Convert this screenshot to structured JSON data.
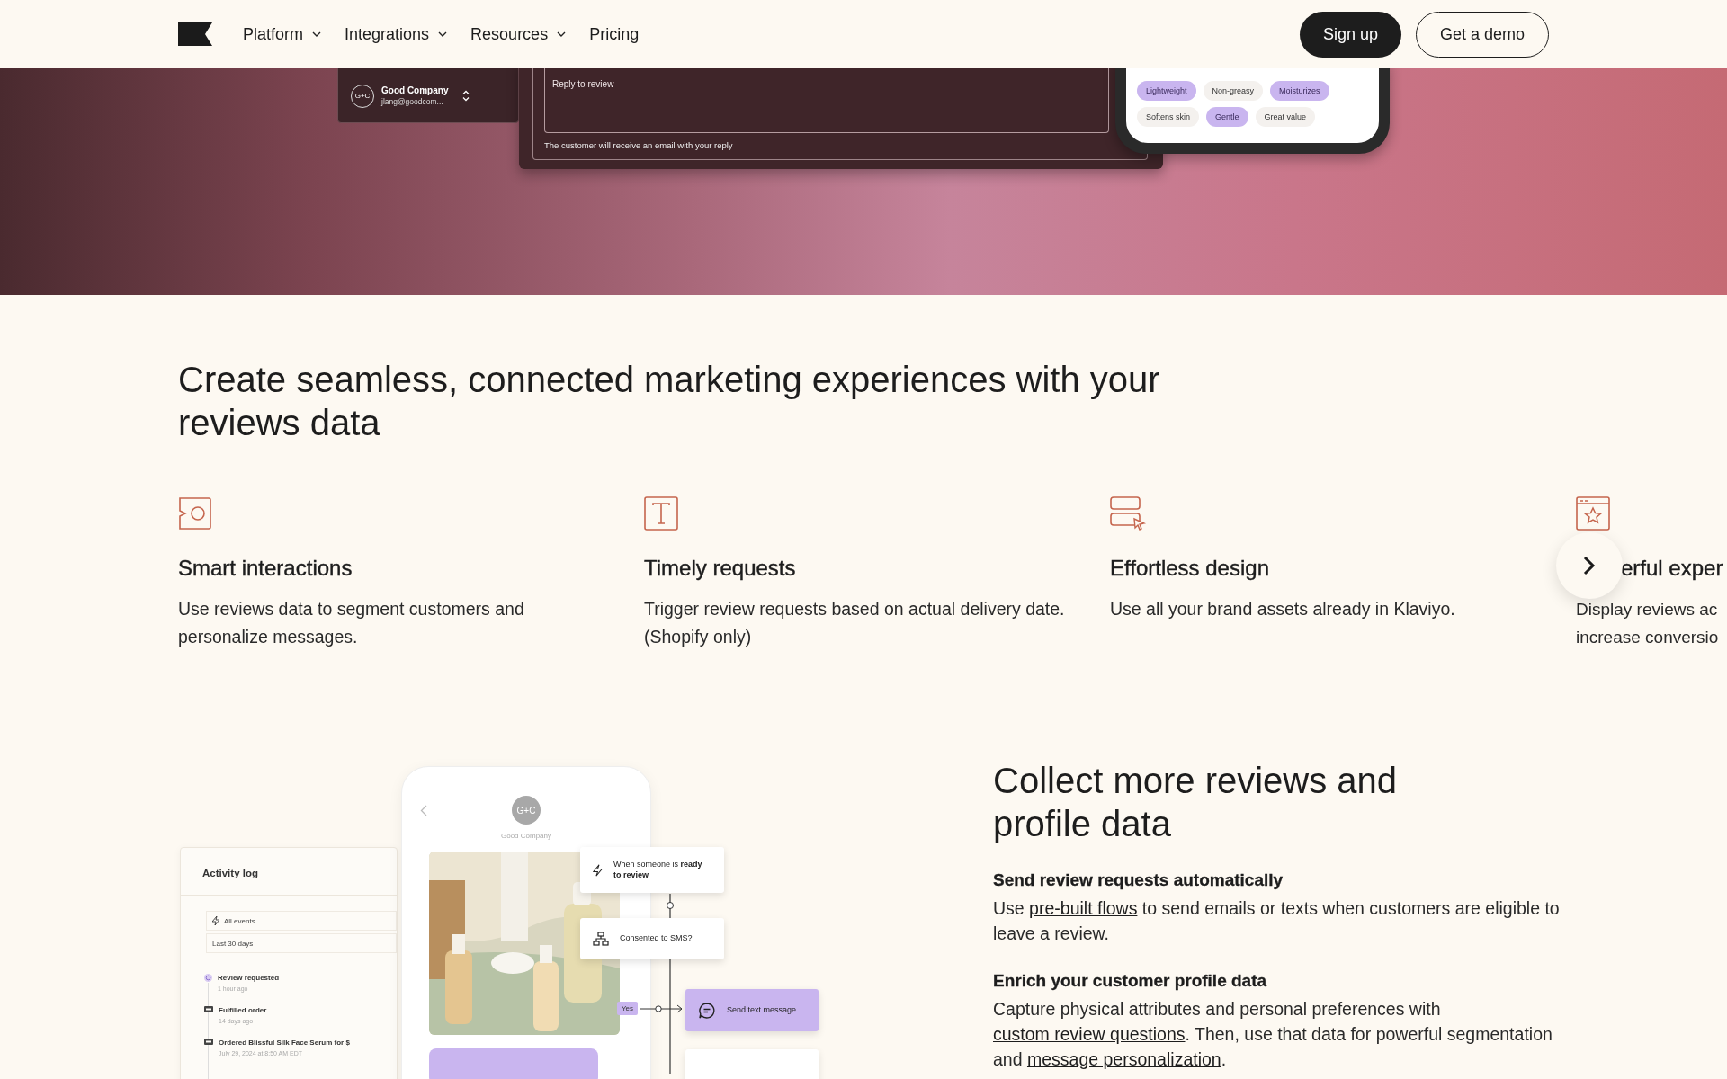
{
  "nav": {
    "links": [
      {
        "label": "Platform",
        "dropdown": true
      },
      {
        "label": "Integrations",
        "dropdown": true
      },
      {
        "label": "Resources",
        "dropdown": true
      },
      {
        "label": "Pricing",
        "dropdown": false
      }
    ],
    "buttons": [
      {
        "label": "Sign up",
        "kind": "primary"
      },
      {
        "label": "Get a demo",
        "kind": "outline"
      }
    ]
  },
  "hero": {
    "account": {
      "avatar": "G+C",
      "name": "Good Company",
      "email": "jlang@goodcom..."
    },
    "reply": {
      "placeholder": "Reply to review",
      "note": "The customer will receive an email with your reply"
    },
    "tags": [
      {
        "label": "Lightweight",
        "selected": true
      },
      {
        "label": "Non-greasy",
        "selected": false
      },
      {
        "label": "Moisturizes",
        "selected": true
      },
      {
        "label": "Softens skin",
        "selected": false
      },
      {
        "label": "Gentle",
        "selected": true
      },
      {
        "label": "Great value",
        "selected": false
      }
    ]
  },
  "features": {
    "heading": "Create seamless, connected marketing experiences with your reviews data",
    "items": [
      {
        "title": "Smart interactions",
        "description": "Use reviews data to segment customers and personalize messages."
      },
      {
        "title": "Timely requests",
        "description": "Trigger review requests based on actual delivery date. (Shopify only)"
      },
      {
        "title": "Effortless design",
        "description": "Use all your brand assets already in Klaviyo."
      },
      {
        "title": "erful exper",
        "description": "Display reviews ac\nincrease conversio"
      }
    ]
  },
  "collect": {
    "illustration": {
      "activity": {
        "title": "Activity log",
        "filters": [
          "All events",
          "Last 30 days"
        ],
        "events": [
          {
            "kind": "review",
            "title": "Review requested",
            "time": "1 hour ago"
          },
          {
            "kind": "order",
            "title": "Fulfilled order",
            "time": "14 days ago"
          },
          {
            "kind": "order",
            "title": "Ordered Blissful Silk Face Serum for $",
            "time": "July 29, 2024 at 8:50 AM EDT"
          }
        ]
      },
      "phone": {
        "avatar": "G+C",
        "name": "Good Company"
      },
      "flow": {
        "trigger": "When someone is **ready to review**",
        "condition": "Consented to SMS?",
        "branch": "Yes",
        "action": "Send text message"
      }
    },
    "heading": "Collect more reviews and profile data",
    "blocks": [
      {
        "title": "Send review requests automatically",
        "parts": [
          {
            "text": "Use ",
            "link": false
          },
          {
            "text": "pre-built flows",
            "link": true
          },
          {
            "text": " to send emails or texts when customers are eligible to leave a review.",
            "link": false
          }
        ]
      },
      {
        "title": "Enrich your customer profile data",
        "parts": [
          {
            "text": "Capture physical attributes and personal preferences with ",
            "link": false
          },
          {
            "text": "custom review questions",
            "link": true
          },
          {
            "text": ". Then, use that data for powerful segmentation and ",
            "link": false
          },
          {
            "text": "message personalization",
            "link": true
          },
          {
            "text": ".",
            "link": false
          }
        ]
      }
    ]
  }
}
